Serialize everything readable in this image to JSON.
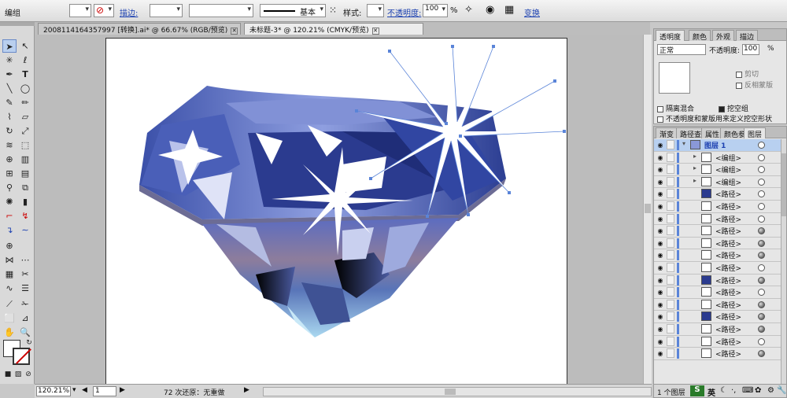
{
  "control": {
    "selection_label": "编组",
    "stroke_link": "描边:",
    "stroke_style_label": "基本",
    "style_label": "样式:",
    "opacity_link": "不透明度:",
    "opacity_value": "100",
    "percent": "%",
    "transform_link": "变换"
  },
  "tabs": [
    {
      "label": "20081141643579​97 [转换].ai* @ 66.67% (RGB/预览)"
    },
    {
      "label": "未标题-3* @ 120.21% (CMYK/预览)"
    }
  ],
  "status": {
    "zoom": "120.21%",
    "artboard": "1",
    "undo": "72 次还原：无重做"
  },
  "transparency": {
    "tabs": [
      "透明度",
      "颜色",
      "外观",
      "描边"
    ],
    "blend_mode": "正常",
    "opacity_label": "不透明度:",
    "opacity_value": "100",
    "percent": "%",
    "clip": "剪切",
    "invert_mask": "反相蒙版",
    "isolate": "隔离混合",
    "knockout": "挖空组",
    "opacity_mask_define": "不透明度和蒙版用来定义挖空形状"
  },
  "layers": {
    "tabs": [
      "渐变",
      "路径查",
      "属性",
      "颜色参",
      "图层"
    ],
    "top": "图层 1",
    "items": [
      "<编组>",
      "<编组>",
      "<编组>",
      "<路径>",
      "<路径>",
      "<路径>",
      "<路径>",
      "<路径>",
      "<路径>",
      "<路径>",
      "<路径>",
      "<路径>",
      "<路径>",
      "<路径>",
      "<路径>",
      "<路径>",
      "<路径>"
    ],
    "count": "1 个图层"
  },
  "ime": {
    "label": "英"
  },
  "colors": {
    "accent": "#5a84d8",
    "diamond_dark": "#2b3b8f",
    "diamond_light": "#9aa8e0"
  }
}
